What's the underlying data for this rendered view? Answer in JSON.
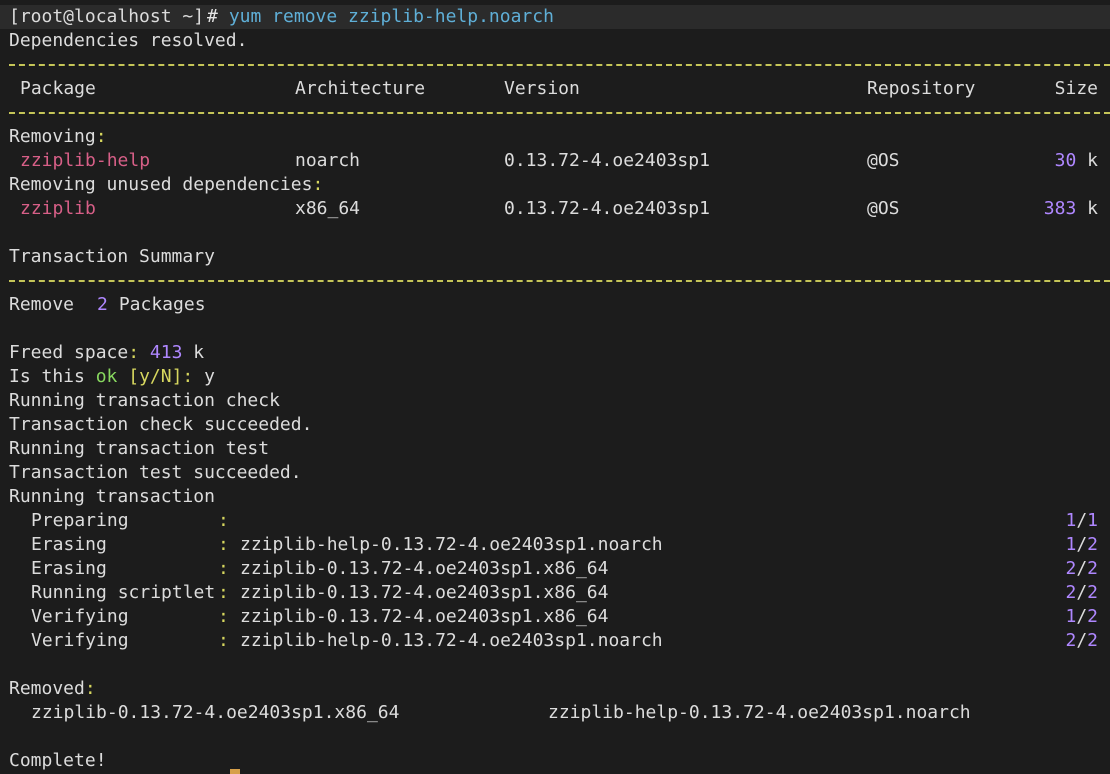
{
  "colors": {
    "background": "#1c1c1c",
    "text": "#dcdcdc",
    "package": "#d75f87",
    "command": "#5fafd7",
    "separator": "#d7d75f",
    "number": "#af87ff",
    "ok": "#87d75f"
  },
  "prompt": {
    "user_host": "[root@localhost ~]",
    "mark": "#",
    "command": " yum remove zziplib-help.noarch"
  },
  "deps_resolved": "Dependencies resolved.",
  "table": {
    "headers": {
      "package": "Package",
      "architecture": "Architecture",
      "version": "Version",
      "repository": "Repository",
      "size": "Size"
    },
    "sections": [
      {
        "title": "Removing",
        "rows": [
          {
            "package": "zziplib-help",
            "arch": "noarch",
            "version": "0.13.72-4.oe2403sp1",
            "repo": "@OS",
            "size_value": "30",
            "size_unit": " k"
          }
        ]
      },
      {
        "title": "Removing unused dependencies",
        "rows": [
          {
            "package": "zziplib",
            "arch": "x86_64",
            "version": "0.13.72-4.oe2403sp1",
            "repo": "@OS",
            "size_value": "383",
            "size_unit": " k"
          }
        ]
      }
    ]
  },
  "summary": {
    "title": "Transaction Summary",
    "remove_label": "Remove",
    "count": "2",
    "packages_word": " Packages",
    "freed_label": "Freed space",
    "freed_value": "413",
    "freed_unit": " k",
    "confirm_prefix": "Is this ",
    "confirm_ok": "ok",
    "confirm_options": "[y/N]",
    "confirm_answer": " y"
  },
  "transaction_messages": [
    "Running transaction check",
    "Transaction check succeeded.",
    "Running transaction test",
    "Transaction test succeeded.",
    "Running transaction"
  ],
  "steps": [
    {
      "action": "Preparing",
      "target": "",
      "progress_num": "1",
      "progress_den": "1"
    },
    {
      "action": "Erasing",
      "target": "zziplib-help-0.13.72-4.oe2403sp1.noarch",
      "progress_num": "1",
      "progress_den": "2"
    },
    {
      "action": "Erasing",
      "target": "zziplib-0.13.72-4.oe2403sp1.x86_64",
      "progress_num": "2",
      "progress_den": "2"
    },
    {
      "action": "Running scriptlet",
      "target": "zziplib-0.13.72-4.oe2403sp1.x86_64",
      "progress_num": "2",
      "progress_den": "2"
    },
    {
      "action": "Verifying",
      "target": "zziplib-0.13.72-4.oe2403sp1.x86_64",
      "progress_num": "1",
      "progress_den": "2"
    },
    {
      "action": "Verifying",
      "target": "zziplib-help-0.13.72-4.oe2403sp1.noarch",
      "progress_num": "2",
      "progress_den": "2"
    }
  ],
  "removed": {
    "title": "Removed",
    "items": [
      "zziplib-0.13.72-4.oe2403sp1.x86_64",
      "zziplib-help-0.13.72-4.oe2403sp1.noarch"
    ]
  },
  "complete": "Complete!"
}
